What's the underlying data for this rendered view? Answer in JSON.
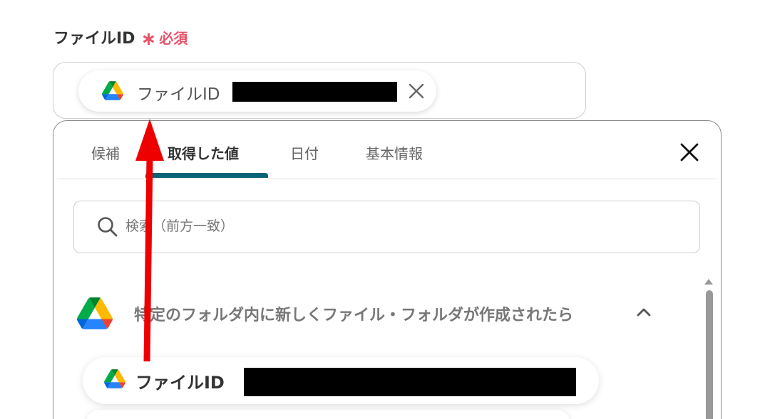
{
  "field": {
    "label": "ファイルID",
    "asterisk": "∗",
    "required": "必須"
  },
  "selected_chip": {
    "label": "ファイルID",
    "icon": "google-drive-icon"
  },
  "tabs": [
    {
      "label": "候補",
      "active": false
    },
    {
      "label": "取得した値",
      "active": true
    },
    {
      "label": "日付",
      "active": false
    },
    {
      "label": "基本情報",
      "active": false
    }
  ],
  "search": {
    "placeholder": "検索（前方一致）"
  },
  "section": {
    "title": "特定のフォルダ内に新しくファイル・フォルダが作成されたら",
    "icon": "google-drive-icon",
    "expanded": true
  },
  "items": [
    {
      "label": "ファイルID",
      "icon": "google-drive-icon"
    }
  ],
  "colors": {
    "required": "#e8556b",
    "tab_indicator": "#0b6378",
    "annotation_arrow": "#ee0000"
  }
}
